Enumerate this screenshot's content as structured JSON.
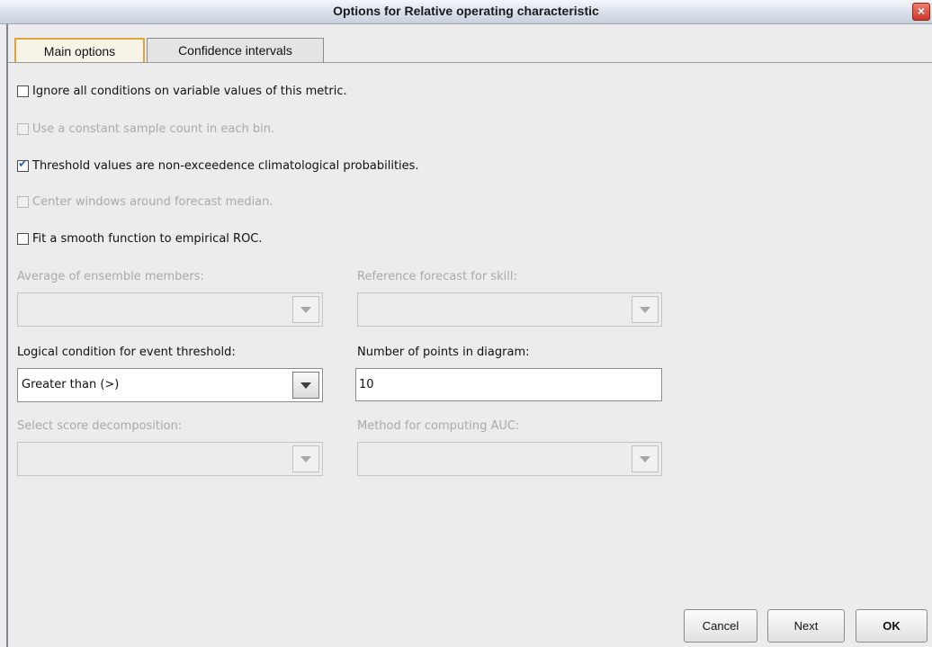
{
  "window": {
    "title": "Options for Relative operating characteristic",
    "close_glyph": "×"
  },
  "tabs": [
    {
      "label": "Main options",
      "active": true
    },
    {
      "label": "Confidence intervals",
      "active": false
    }
  ],
  "checkboxes": [
    {
      "label": "Ignore all conditions on variable values of this metric.",
      "checked": false,
      "enabled": true
    },
    {
      "label": "Use a constant sample count in each bin.",
      "checked": false,
      "enabled": false
    },
    {
      "label": "Threshold values are non-exceedence climatological probabilities.",
      "checked": true,
      "enabled": true
    },
    {
      "label": "Center windows around forecast median.",
      "checked": false,
      "enabled": false
    },
    {
      "label": "Fit a smooth function to empirical ROC.",
      "checked": false,
      "enabled": true
    }
  ],
  "check_glyph": "✔",
  "fields": {
    "average_ensemble": {
      "label": "Average of ensemble members:",
      "value": "",
      "enabled": false
    },
    "reference_forecast": {
      "label": "Reference forecast for skill:",
      "value": "",
      "enabled": false
    },
    "logical_condition": {
      "label": "Logical condition for event threshold:",
      "value": "Greater than (>)",
      "enabled": true
    },
    "num_points": {
      "label": "Number of points in diagram:",
      "value": "10",
      "enabled": true
    },
    "score_decomposition": {
      "label": "Select score decomposition:",
      "value": "",
      "enabled": false
    },
    "auc_method": {
      "label": "Method for computing AUC:",
      "value": "",
      "enabled": false
    }
  },
  "buttons": {
    "cancel": "Cancel",
    "next": "Next",
    "ok": "OK"
  }
}
